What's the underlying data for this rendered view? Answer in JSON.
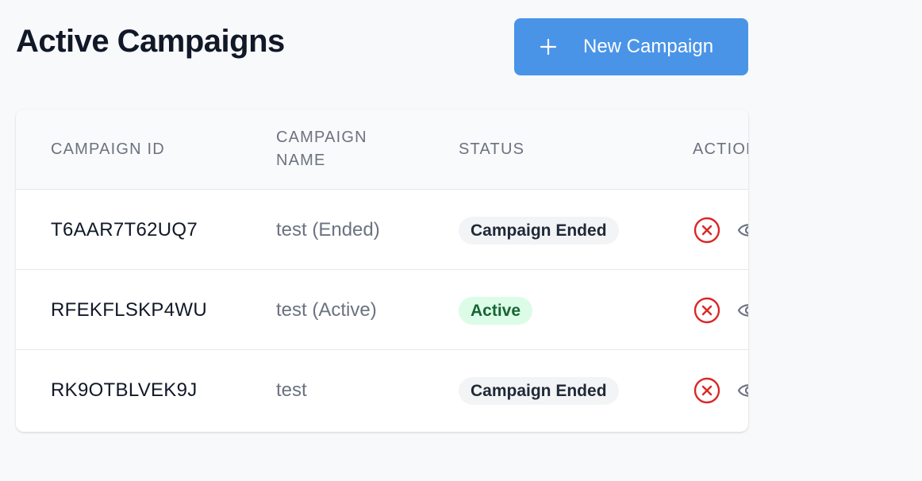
{
  "page": {
    "title": "Active Campaigns",
    "new_button_label": "New Campaign"
  },
  "colors": {
    "primary_button": "#4a94e8",
    "cancel_icon": "#dc2626",
    "badge_ended_bg": "#f3f4f6",
    "badge_active_bg": "#dcfce7",
    "badge_active_text": "#166534"
  },
  "table": {
    "columns": [
      "Campaign ID",
      "Campaign Name",
      "Status",
      "Actions"
    ],
    "rows": [
      {
        "id": "T6AAR7T62UQ7",
        "name": "test (Ended)",
        "status": "Campaign Ended",
        "status_kind": "ended"
      },
      {
        "id": "RFEKFLSKP4WU",
        "name": "test (Active)",
        "status": "Active",
        "status_kind": "active"
      },
      {
        "id": "RK9OTBLVEK9J",
        "name": "test",
        "status": "Campaign Ended",
        "status_kind": "ended"
      }
    ],
    "action_icons": [
      "cancel-icon",
      "eye-icon"
    ]
  }
}
